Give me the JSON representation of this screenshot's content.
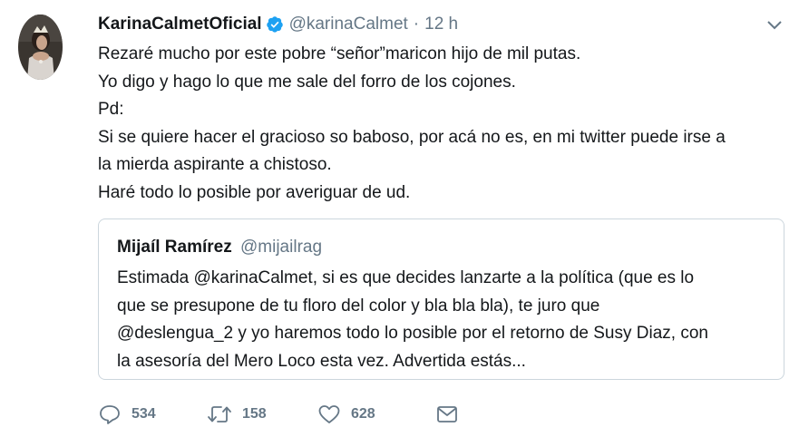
{
  "tweet": {
    "display_name": "KarinaCalmetOficial",
    "verified_icon": "verified-badge-icon",
    "handle": "@karinaCalmet",
    "separator": "·",
    "time": "12 h",
    "lines": [
      "Rezaré mucho por este pobre “señor”maricon hijo de mil putas.",
      "Yo digo y hago lo que me sale del forro de los cojones.",
      "Pd:",
      "Si se quiere hacer el gracioso so baboso, por acá no es, en mi twitter puede irse a",
      "la mierda aspirante a chistoso.",
      "Haré todo lo posible por averiguar de ud."
    ]
  },
  "quote": {
    "display_name": "Mijaíl Ramírez",
    "handle": "@mijailrag",
    "lines": [
      "Estimada @karinaCalmet, si es que decides lanzarte a la política (que es lo",
      "que se presupone de tu floro del color y bla bla bla), te juro que",
      "@deslengua_2 y yo haremos todo lo posible por el retorno de Susy Diaz, con",
      "la asesoría del Mero Loco esta vez. Advertida estás..."
    ]
  },
  "actions": {
    "reply_count": "534",
    "retweet_count": "158",
    "like_count": "628"
  },
  "colors": {
    "text": "#14171a",
    "secondary": "#657786",
    "verified": "#1da1f2",
    "border": "#ccd6dd"
  }
}
